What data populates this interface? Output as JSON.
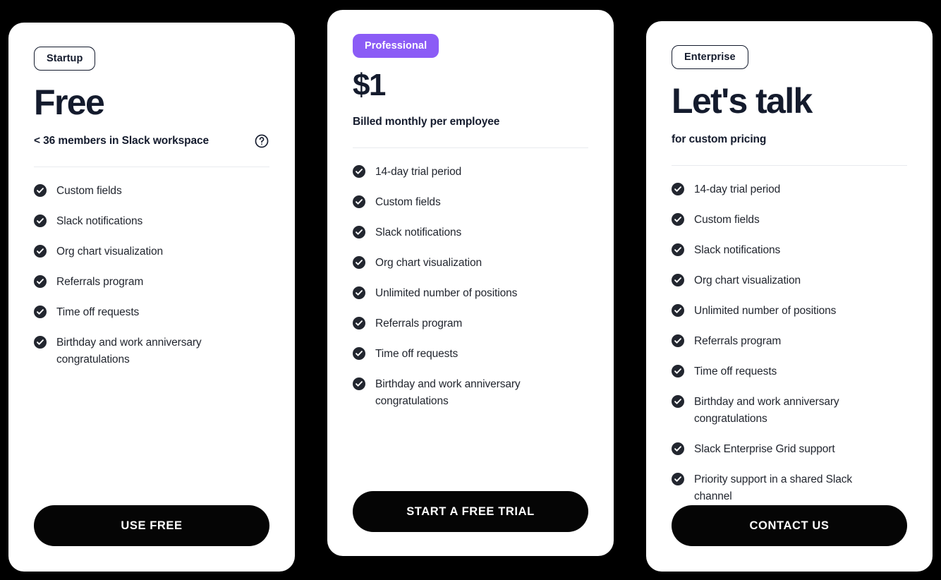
{
  "page": {
    "background_color": "#000000",
    "card_background": "#ffffff",
    "accent_color": "#8b5cf6",
    "text_color": "#141b2d",
    "cta_color": "#050505",
    "divider_color": "#e9eaee"
  },
  "plans": [
    {
      "badge": "Startup",
      "badge_style": "outline",
      "price": "Free",
      "subtitle": "< 36 members in Slack workspace",
      "has_help_icon": true,
      "help_icon": "question-mark-circle-icon",
      "features": [
        "Custom fields",
        "Slack notifications",
        "Org chart visualization",
        "Referrals program",
        "Time off requests",
        "Birthday and work anniversary congratulations"
      ],
      "cta": "USE FREE"
    },
    {
      "badge": "Professional",
      "badge_style": "filled",
      "price": "$1",
      "subtitle": "Billed monthly per employee",
      "has_help_icon": false,
      "help_icon": "",
      "features": [
        "14-day trial period",
        "Custom fields",
        "Slack notifications",
        "Org chart visualization",
        "Unlimited number of positions",
        "Referrals program",
        "Time off requests",
        "Birthday and work anniversary congratulations"
      ],
      "cta": "START A FREE TRIAL"
    },
    {
      "badge": "Enterprise",
      "badge_style": "outline",
      "price": "Let's talk",
      "subtitle": "for custom pricing",
      "has_help_icon": false,
      "help_icon": "",
      "features": [
        "14-day trial period",
        "Custom fields",
        "Slack notifications",
        "Org chart visualization",
        "Unlimited number of positions",
        "Referrals program",
        "Time off requests",
        "Birthday and work anniversary congratulations",
        "Slack Enterprise Grid support",
        "Priority support in a shared Slack channel"
      ],
      "cta": "CONTACT US"
    }
  ]
}
